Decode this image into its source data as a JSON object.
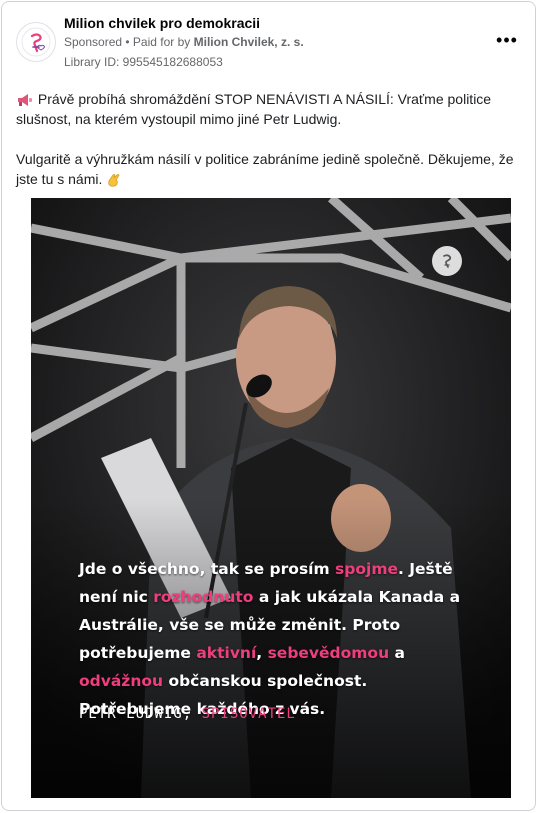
{
  "page": {
    "name": "Milion chvilek pro demokracii",
    "sponsored": "Sponsored",
    "separator": " • ",
    "paid_for_prefix": "Paid for by ",
    "paid_for_by": "Milion Chvilek, z. s.",
    "library_id": "Library ID: 995545182688053",
    "more_label": "•••"
  },
  "post": {
    "line1": "Právě probíhá shromáždění STOP NENÁVISTI A NÁSILÍ: Vraťme politice slušnost, na kterém vystoupil mimo jiné Petr Ludwig.",
    "line2": "Vulgaritě a výhružkám násilí v politice zabráníme jedině společně. Děkujeme, že jste tu s námi."
  },
  "media": {
    "quote": {
      "p1": "Jde o všechno, tak se prosím ",
      "h1": "spojme",
      "p2": ". Ještě není nic ",
      "h2": "rozhodnuto",
      "p3": " a jak ukázala Kanada a Austrálie, vše se může změnit. Proto potřebujeme ",
      "h3": "aktivní",
      "p4": ", ",
      "h4": "sebevědomou",
      "p5": " a ",
      "h5": "odvážnou",
      "p6": " občanskou společnost. Potřebujeme každého z vás."
    },
    "attribution_name": "PETR LUDWIG, ",
    "attribution_role": "SPISOVATEL"
  },
  "colors": {
    "accent": "#ee3e7d",
    "text_secondary": "#65676b",
    "border": "#cfd3d8"
  },
  "icons": {
    "avatar": "milion-chvilek-logo-icon",
    "megaphone": "megaphone-icon",
    "thumbs": "clapping-hands-icon",
    "more": "more-options-icon"
  }
}
